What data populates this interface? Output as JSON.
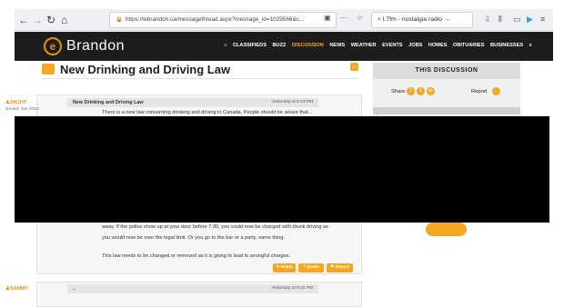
{
  "browser": {
    "back_icon": "back-arrow-icon",
    "forward_icon": "forward-arrow-icon",
    "reload_icon": "reload-icon",
    "home_icon": "home-icon",
    "url": "https://wbrandon.ca/messagethread.aspx?message_id=1029566&c...",
    "search_value": "I.7fm - nostalgia radio",
    "search_arrow": "→",
    "colors": {
      "chrome_bg": "#f0f0f4",
      "lock": "#2a9d3c"
    }
  },
  "site": {
    "logo_mark": "e",
    "logo_text": "Brandon",
    "nav": [
      "CLASSIFIEDS",
      "BUZZ",
      "DISCUSSION",
      "NEWS",
      "WEATHER",
      "EVENTS",
      "JOBS",
      "HOMES",
      "OBITUARIES",
      "BUSINESSES"
    ],
    "nav_active": "DISCUSSION",
    "accent": "#f5a623",
    "header_bg": "#1d1d1d"
  },
  "page": {
    "title": "New Drinking and Driving Law"
  },
  "posts": [
    {
      "author": "ZACHT",
      "joined": "Joined: Jun 2013",
      "subject": "New Drinking and Driving Law",
      "date": "Yesterday at 6:13 PM",
      "body_top": "There is a new law concerning drinking and driving in Canada. People should be aware that...",
      "body_lines": [
        "away. If the police show up at your door before 7:30, you could now be charged with drunk driving as",
        "you would now be over the legal limit. Or you go to the bar or a party, same thing.",
        "",
        "This law needs to be changed or removed as it is going to lead to wrongful charges."
      ],
      "buttons": {
        "reply": "Reply",
        "quote": "Quote",
        "report": "Report"
      }
    },
    {
      "author": "SAMMY",
      "subject": "..",
      "date": "Yesterday at 6:22 PM"
    }
  ],
  "sidebar": {
    "title": "THIS DISCUSSION",
    "share_label": "Share",
    "share_icons": [
      "f",
      "t",
      "m"
    ],
    "report_label": "Report",
    "box2_title": "..."
  }
}
